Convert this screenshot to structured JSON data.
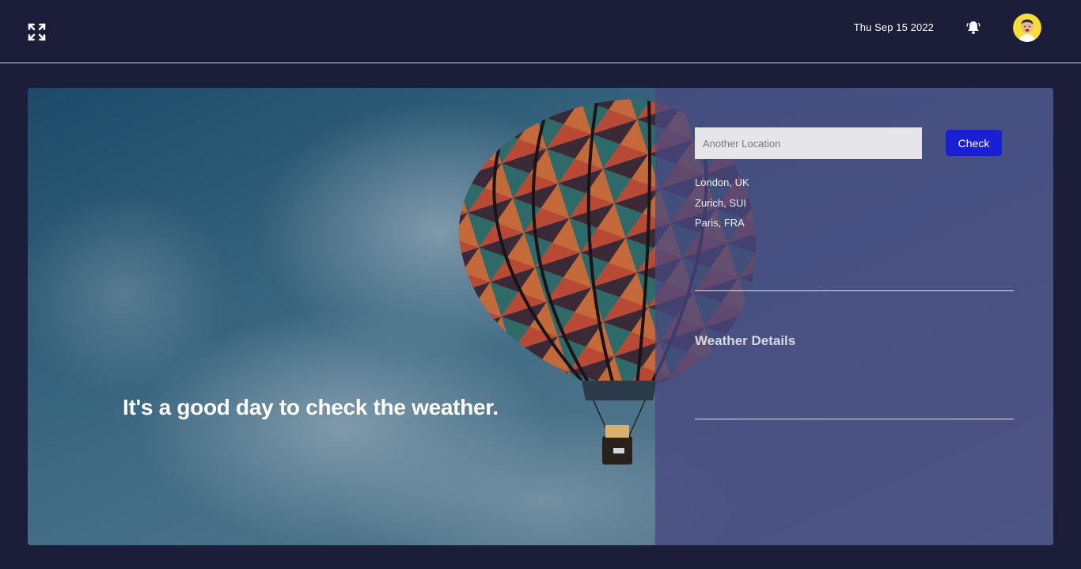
{
  "header": {
    "date": "Thu Sep 15 2022",
    "fullscreen_icon": "fullscreen-icon",
    "bell_icon": "bell-icon",
    "avatar": "avatar"
  },
  "hero": {
    "tagline": "It's a good day to check the weather."
  },
  "panel": {
    "search": {
      "placeholder": "Another Location",
      "value": ""
    },
    "check_label": "Check",
    "locations": [
      "London, UK",
      "Zurich, SUI",
      "Paris, FRA"
    ],
    "details_title": "Weather Details"
  },
  "colors": {
    "background": "#1c1d38",
    "panel": "#484880",
    "accent_button": "#1a1fd6"
  }
}
